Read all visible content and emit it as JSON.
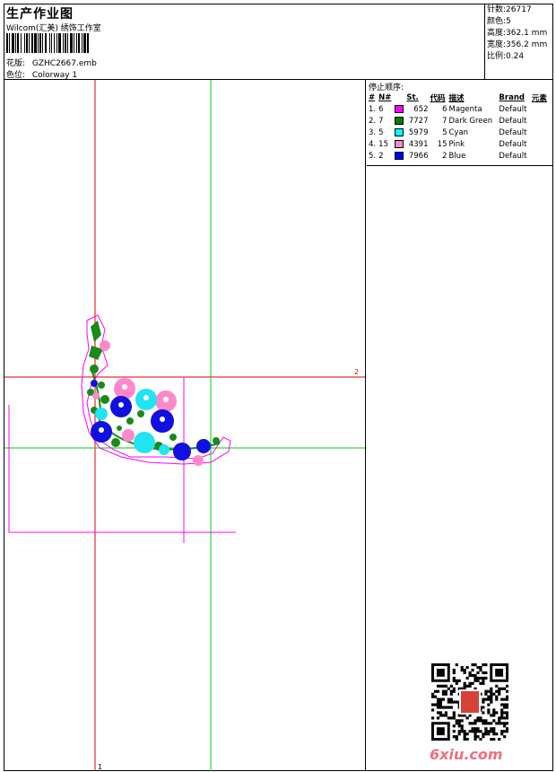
{
  "header": {
    "title": "生产作业图",
    "studio": "Wilcom(汇美) 绣饰工作室",
    "design_label": "花版:",
    "design_value": "GZHC2667.emb",
    "colorway_label": "色位:",
    "colorway_value": "Colorway 1"
  },
  "stats": [
    {
      "label": "针数:",
      "value": "26717"
    },
    {
      "label": "颜色:",
      "value": "5"
    },
    {
      "label": "高度:",
      "value": "362.1 mm"
    },
    {
      "label": "宽度:",
      "value": "356.2 mm"
    },
    {
      "label": "比例:",
      "value": "0.24"
    }
  ],
  "stop_sequence": {
    "title": "停止顺序:",
    "headers": [
      "#",
      "N#",
      "St.",
      "代码",
      "描述",
      "Brand",
      "元素"
    ],
    "rows": [
      {
        "idx": "1.",
        "n": "6",
        "color": "#ff00ff",
        "st": "652",
        "code": "6",
        "desc": "Magenta",
        "brand": "Default"
      },
      {
        "idx": "2.",
        "n": "7",
        "color": "#008000",
        "st": "7727",
        "code": "7",
        "desc": "Dark Green",
        "brand": "Default"
      },
      {
        "idx": "3.",
        "n": "5",
        "color": "#00ffff",
        "st": "5979",
        "code": "5",
        "desc": "Cyan",
        "brand": "Default"
      },
      {
        "idx": "4.",
        "n": "15",
        "color": "#ff88cc",
        "st": "4391",
        "code": "15",
        "desc": "Pink",
        "brand": "Default"
      },
      {
        "idx": "5.",
        "n": "2",
        "color": "#0000ff",
        "st": "7966",
        "code": "2",
        "desc": "Blue",
        "brand": "Default"
      }
    ]
  },
  "canvas": {
    "marker_right": "2",
    "marker_bottom": "1"
  },
  "watermark": "6xiu.com",
  "icons": {
    "barcode": "barcode-icon",
    "qr": "qr-code-icon"
  }
}
